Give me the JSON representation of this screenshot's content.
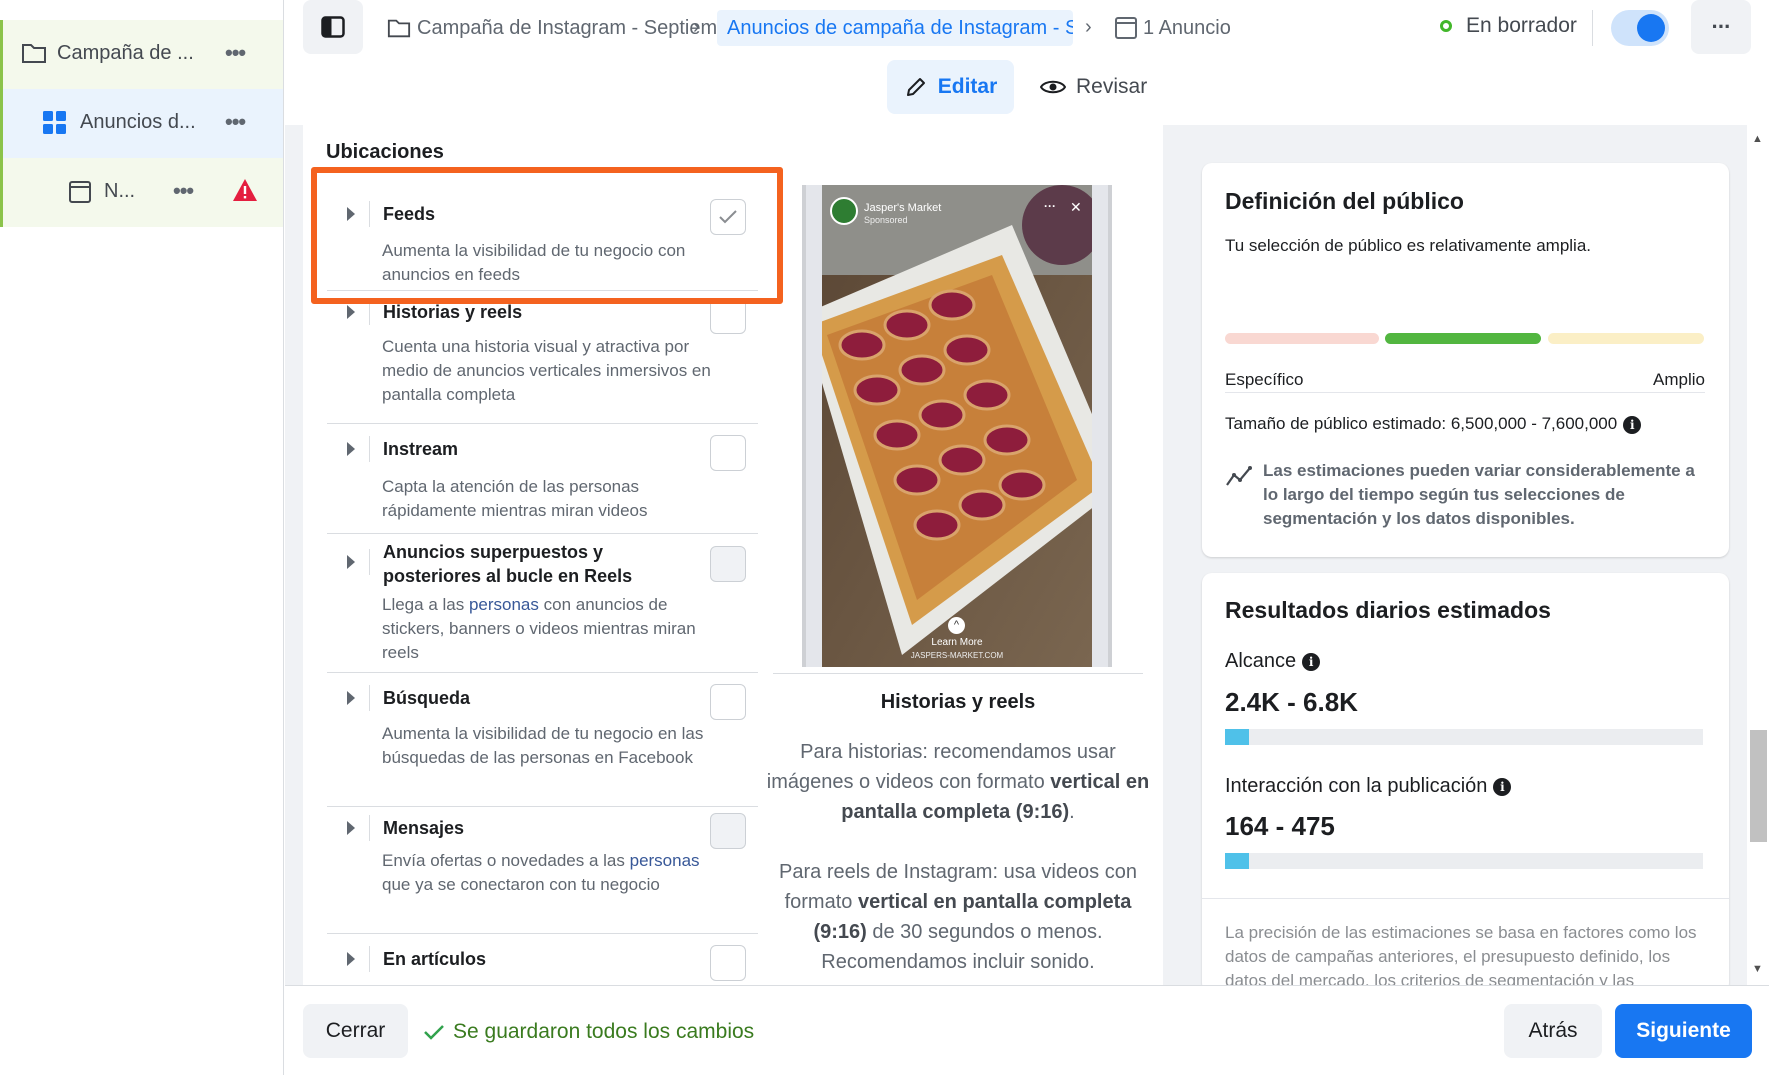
{
  "sidebar": {
    "items": [
      {
        "label": "Campaña de ...",
        "icon": "folder-icon"
      },
      {
        "label": "Anuncios d...",
        "icon": "grid-icon"
      },
      {
        "label": "N...",
        "icon": "ad-icon",
        "warning_icon": "warning-icon"
      }
    ],
    "more": "•••"
  },
  "topbar": {
    "breadcrumbs": [
      {
        "label": "Campaña de Instagram - Septiembre"
      },
      {
        "label": "Anuncios de campaña de Instagram - S"
      },
      {
        "label": "1 Anuncio"
      }
    ],
    "status": "En borrador",
    "more": "···",
    "toggle_on": true
  },
  "modes": {
    "edit": "Editar",
    "review": "Revisar"
  },
  "placements": {
    "title": "Ubicaciones",
    "options": [
      {
        "title": "Feeds",
        "desc": "Aumenta la visibilidad de tu negocio con anuncios en feeds",
        "checked": true,
        "highlighted": true
      },
      {
        "title": "Historias y reels",
        "desc": "Cuenta una historia visual y atractiva por medio de anuncios verticales inmersivos en pantalla completa",
        "checked": false
      },
      {
        "title": "Instream",
        "desc": "Capta la atención de las personas rápidamente mientras miran videos",
        "checked": false
      },
      {
        "title": "Anuncios superpuestos y posteriores al bucle en Reels",
        "desc_a": "Llega a las ",
        "desc_link": "personas",
        "desc_b": " con anuncios de stickers, banners o videos mientras miran reels",
        "checked": false,
        "disabled": true
      },
      {
        "title": "Búsqueda",
        "desc": "Aumenta la visibilidad de tu negocio en las búsquedas de las personas en Facebook",
        "checked": false
      },
      {
        "title": "Mensajes",
        "desc_a": "Envía ofertas o novedades a las ",
        "desc_link": "personas",
        "desc_b": " que ya se conectaron con tu negocio",
        "checked": false,
        "disabled": true
      },
      {
        "title": "En artículos",
        "checked": false
      }
    ]
  },
  "preview": {
    "brand": "Jasper's Market",
    "sponsored": "Sponsored",
    "cta": "Learn More",
    "url": "JASPERS-MARKET.COM",
    "title": "Historias y reels",
    "p1_a": "Para historias: recomendamos usar imágenes o videos con formato ",
    "p1_b": "vertical en pantalla completa (9:16)",
    "p1_c": ".",
    "p2_a": "Para reels de Instagram: usa videos con formato ",
    "p2_b": "vertical en pantalla completa (9:16)",
    "p2_c": " de 30 segundos o menos. Recomendamos incluir sonido."
  },
  "audience": {
    "title": "Definición del público",
    "summary": "Tu selección de público es relativamente amplia.",
    "specific": "Específico",
    "broad": "Amplio",
    "size_label": "Tamaño de público estimado: 6,500,000 - 7,600,000",
    "note": "Las estimaciones pueden variar considerablemente a lo largo del tiempo según tus selecciones de segmentación y los datos disponibles.",
    "colors": {
      "specific": "#f9d8d2",
      "fit": "#52b640",
      "broad": "#fbefc6"
    }
  },
  "results": {
    "title": "Resultados diarios estimados",
    "reach_label": "Alcance",
    "reach_value": "2.4K - 6.8K",
    "reach_fill": 0.05,
    "engagement_label": "Interacción con la publicación",
    "engagement_value": "164 - 475",
    "engagement_fill": 0.05,
    "note": "La precisión de las estimaciones se basa en factores como los datos de campañas anteriores, el presupuesto definido, los datos del mercado, los criterios de segmentación y las"
  },
  "footer": {
    "close": "Cerrar",
    "saved": "Se guardaron todos los cambios",
    "back": "Atrás",
    "next": "Siguiente"
  }
}
